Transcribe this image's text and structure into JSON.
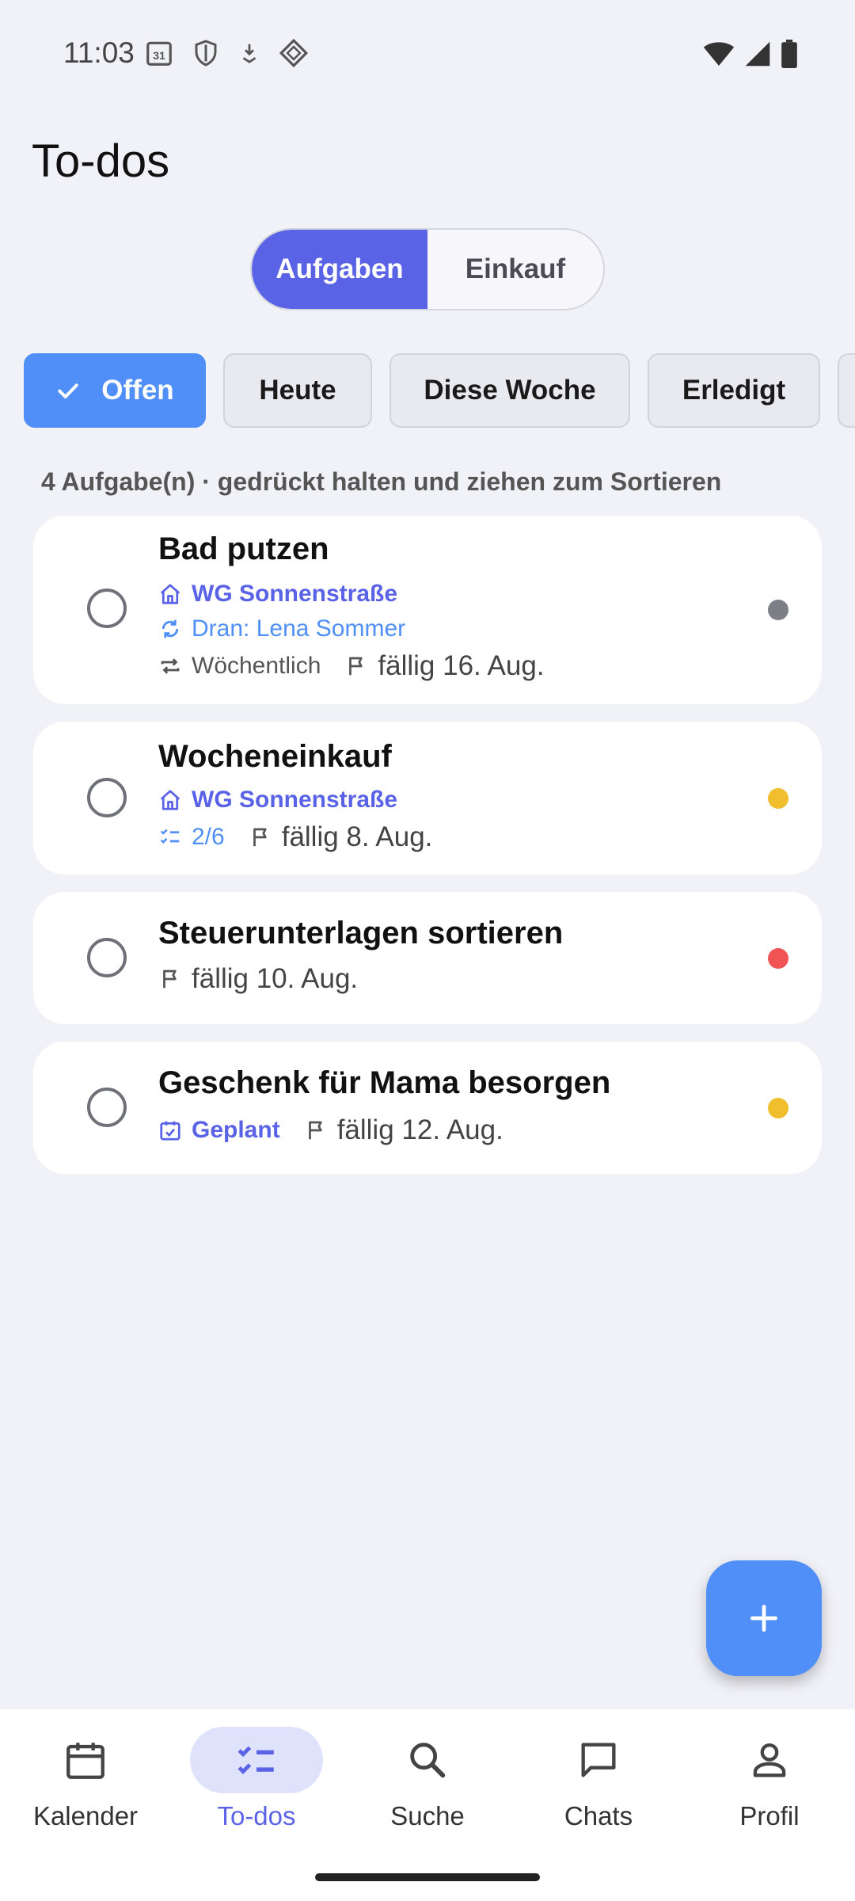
{
  "status_bar": {
    "time": "11:03",
    "left_icons": [
      "calendar-31-icon",
      "shield-icon",
      "download-icon",
      "diamond-icon"
    ],
    "right_icons": [
      "wifi-icon",
      "signal-icon",
      "battery-icon"
    ]
  },
  "header": {
    "title": "To-dos"
  },
  "segments": [
    {
      "label": "Aufgaben",
      "active": true
    },
    {
      "label": "Einkauf",
      "active": false
    }
  ],
  "filters": [
    {
      "label": "Offen",
      "active": true
    },
    {
      "label": "Heute",
      "active": false
    },
    {
      "label": "Diese Woche",
      "active": false
    },
    {
      "label": "Erledigt",
      "active": false
    }
  ],
  "hint": "4 Aufgabe(n) · gedrückt halten und ziehen zum Sortieren",
  "tasks": [
    {
      "title": "Bad putzen",
      "group": "WG Sonnenstraße",
      "turn": "Dran: Lena Sommer",
      "repeat": "Wöchentlich",
      "due": "fällig 16. Aug.",
      "priority_color": "#7d7f86"
    },
    {
      "title": "Wocheneinkauf",
      "group": "WG Sonnenstraße",
      "checklist": "2/6",
      "due": "fällig 8. Aug.",
      "priority_color": "#f1bf2e"
    },
    {
      "title": "Steuerunterlagen sortieren",
      "due": "fällig 10. Aug.",
      "priority_color": "#f05454"
    },
    {
      "title": "Geschenk für Mama besorgen",
      "planned": "Geplant",
      "due": "fällig 12. Aug.",
      "priority_color": "#f1bf2e"
    }
  ],
  "fab": {
    "icon": "plus-icon"
  },
  "nav": [
    {
      "label": "Kalender",
      "icon": "calendar-icon",
      "active": false
    },
    {
      "label": "To-dos",
      "icon": "checklist-icon",
      "active": true
    },
    {
      "label": "Suche",
      "icon": "search-icon",
      "active": false
    },
    {
      "label": "Chats",
      "icon": "chat-icon",
      "active": false
    },
    {
      "label": "Profil",
      "icon": "person-icon",
      "active": false
    }
  ],
  "colors": {
    "accent": "#5a63e6",
    "primary_blue": "#4f8ff7",
    "background": "#f1f2f7"
  }
}
